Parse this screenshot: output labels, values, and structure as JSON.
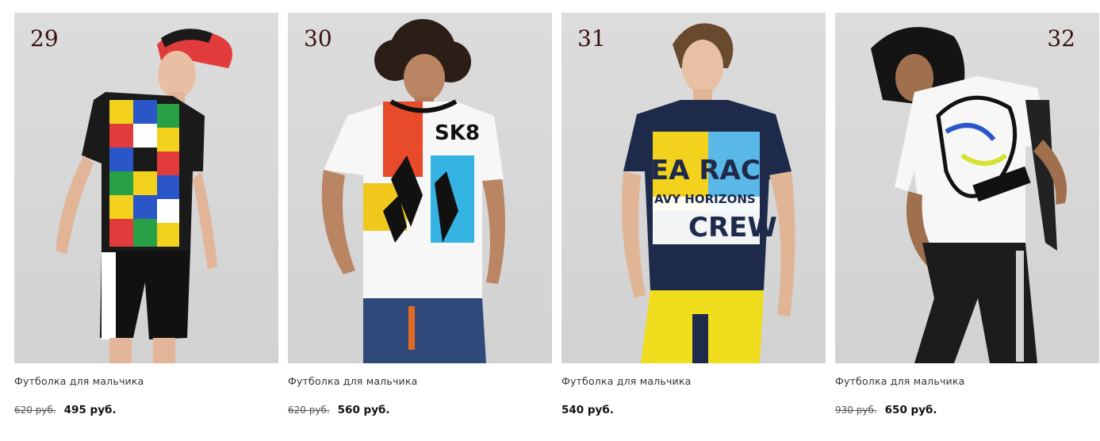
{
  "products": [
    {
      "badge": "29",
      "title": "Футболка для мальчика",
      "old_price": "620 руб.",
      "price": "495 руб.",
      "image": "boy-in-colorful-mickey-print-tshirt-and-black-shorts"
    },
    {
      "badge": "30",
      "title": "Футболка для мальчика",
      "old_price": "620 руб.",
      "price": "560 руб.",
      "image": "boy-in-white-ninja-sk8-tshirt-and-jeans"
    },
    {
      "badge": "31",
      "title": "Футболка для мальчика",
      "old_price": "",
      "price": "540 руб.",
      "image": "boy-in-navy-sea-race-crew-tshirt-and-yellow-pants"
    },
    {
      "badge": "32",
      "title": "Футболка для мальчика",
      "old_price": "930 руб.",
      "price": "650 руб.",
      "image": "boy-in-hood-with-white-disney-print-tshirt-and-black-jeans"
    }
  ],
  "colors": {
    "badge": "#3a1010",
    "photo_bg": "#d6d6d6",
    "price": "#111111",
    "old_price": "#555555"
  }
}
